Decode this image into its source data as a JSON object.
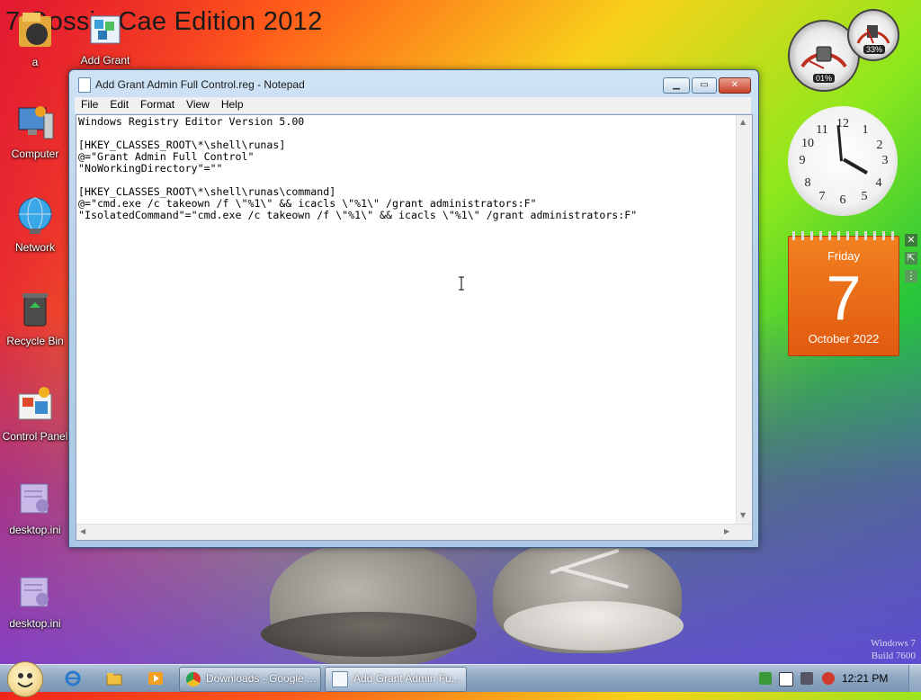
{
  "wallpaper": {
    "title": "7 Gossip Cae Edition 2012",
    "watermark_line1": "Windows 7",
    "watermark_line2": "Build 7600"
  },
  "desktop_icons": [
    {
      "label": "a",
      "icon": "folder-user-icon"
    },
    {
      "label": "Add Grant",
      "icon": "registry-file-icon"
    },
    {
      "label": "Computer",
      "icon": "computer-icon"
    },
    {
      "label": "Network",
      "icon": "network-globe-icon"
    },
    {
      "label": "Recycle Bin",
      "icon": "recycle-bin-icon"
    },
    {
      "label": "Control Panel",
      "icon": "control-panel-icon"
    },
    {
      "label": "desktop.ini",
      "icon": "settings-file-icon"
    },
    {
      "label": "desktop.ini",
      "icon": "settings-file-icon"
    }
  ],
  "notepad": {
    "title": "Add Grant Admin Full Control.reg - Notepad",
    "menu": [
      "File",
      "Edit",
      "Format",
      "View",
      "Help"
    ],
    "content": "Windows Registry Editor Version 5.00\n\n[HKEY_CLASSES_ROOT\\*\\shell\\runas]\n@=\"Grant Admin Full Control\"\n\"NoWorkingDirectory\"=\"\"\n\n[HKEY_CLASSES_ROOT\\*\\shell\\runas\\command]\n@=\"cmd.exe /c takeown /f \\\"%1\\\" && icacls \\\"%1\\\" /grant administrators:F\"\n\"IsolatedCommand\"=\"cmd.exe /c takeown /f \\\"%1\\\" && icacls \\\"%1\\\" /grant administrators:F\""
  },
  "gadgets": {
    "cpu_meter_label": "01%",
    "memory_meter_label": "33%",
    "clock_numbers": [
      "12",
      "1",
      "2",
      "3",
      "4",
      "5",
      "6",
      "7",
      "8",
      "9",
      "10",
      "11"
    ],
    "calendar": {
      "day": "Friday",
      "date": "7",
      "month_year": "October 2022"
    }
  },
  "taskbar": {
    "tasks": [
      {
        "label": "Downloads - Google ...",
        "icon": "chrome-icon"
      },
      {
        "label": "Add Grant Admin Fu...",
        "icon": "notepad-icon"
      }
    ],
    "time": "12:21 PM"
  },
  "colors": {
    "calendar_orange": "#e86a14",
    "taskbar_blue": "#8ea7c2",
    "close_red": "#c8402a"
  }
}
